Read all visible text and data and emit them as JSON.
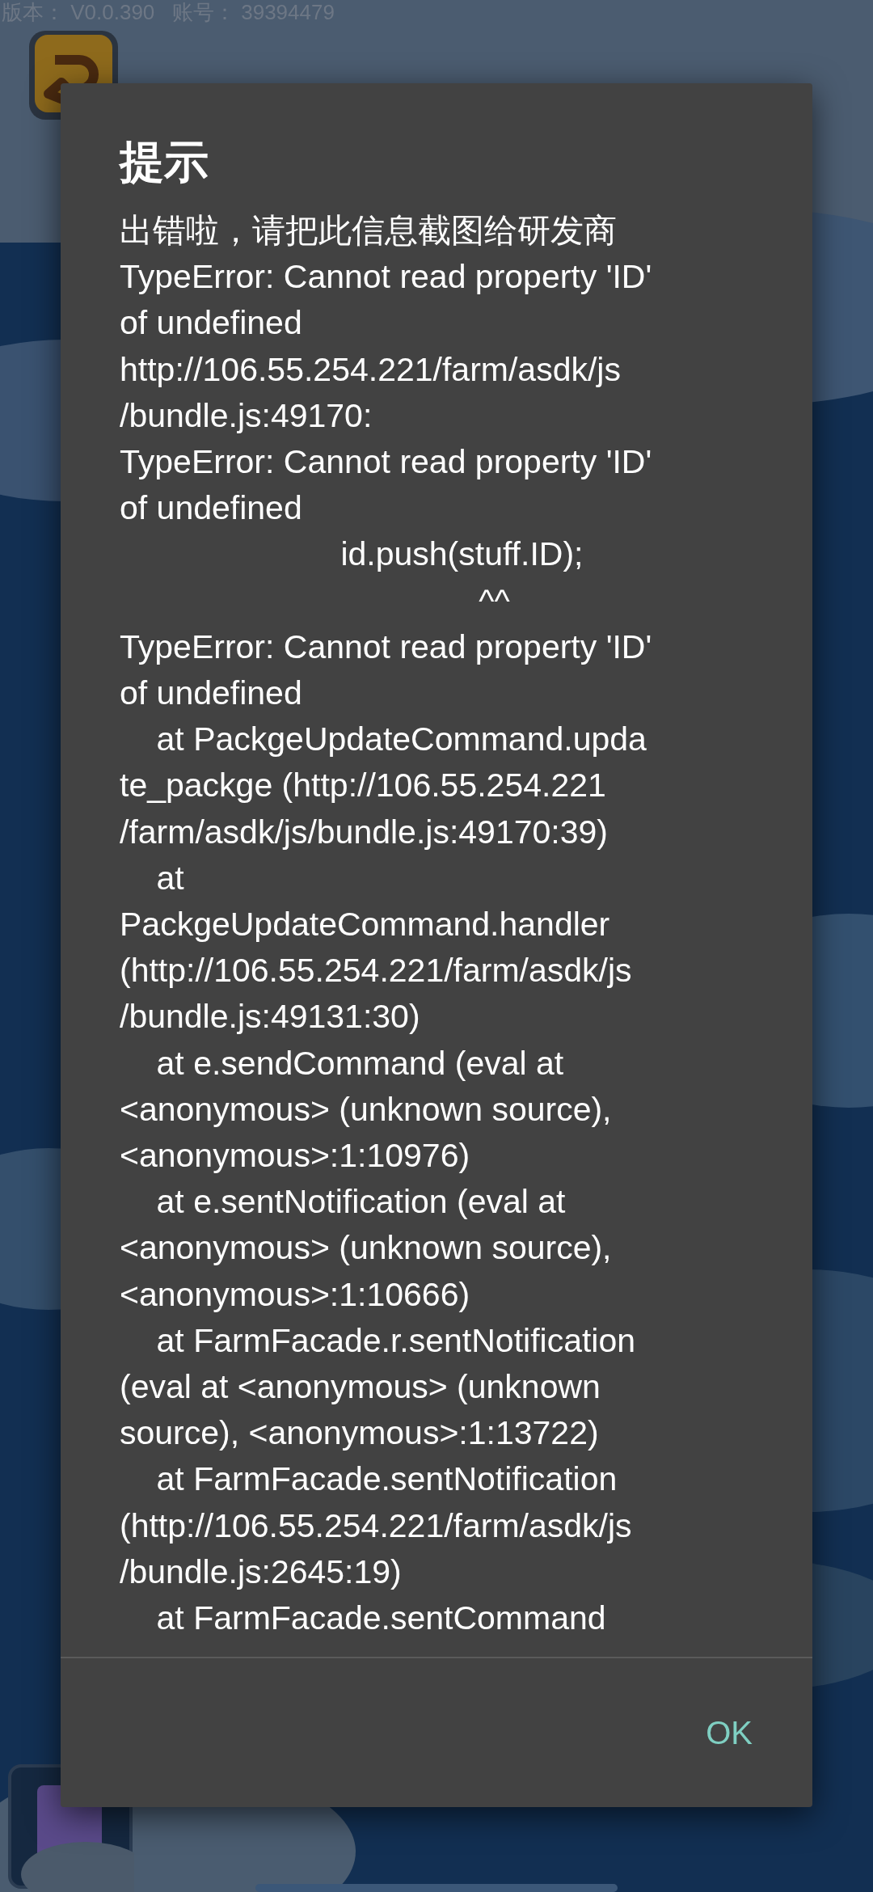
{
  "status_text": "版本： V0.0.390   账号： 39394479",
  "dialog": {
    "title": "提示",
    "message_lines": [
      "出错啦，请把此信息截图给研发商",
      "TypeError: Cannot read property 'ID'",
      "of undefined",
      "http://106.55.254.221/farm/asdk/js",
      "/bundle.js:49170:",
      "TypeError: Cannot read property 'ID'",
      "of undefined",
      "                        id.push(stuff.ID);",
      "                                       ^^",
      "TypeError: Cannot read property 'ID'",
      "of undefined",
      "    at PackgeUpdateCommand.upda",
      "te_packge (http://106.55.254.221",
      "/farm/asdk/js/bundle.js:49170:39)",
      "    at",
      "PackgeUpdateCommand.handler",
      "(http://106.55.254.221/farm/asdk/js",
      "/bundle.js:49131:30)",
      "    at e.sendCommand (eval at",
      "<anonymous> (unknown source),",
      "<anonymous>:1:10976)",
      "    at e.sentNotification (eval at",
      "<anonymous> (unknown source),",
      "<anonymous>:1:10666)",
      "    at FarmFacade.r.sentNotification",
      "(eval at <anonymous> (unknown",
      "source), <anonymous>:1:13722)",
      "    at FarmFacade.sentNotification",
      "(http://106.55.254.221/farm/asdk/js",
      "/bundle.js:2645:19)",
      "    at FarmFacade.sentCommand"
    ],
    "ok_button": "OK"
  }
}
